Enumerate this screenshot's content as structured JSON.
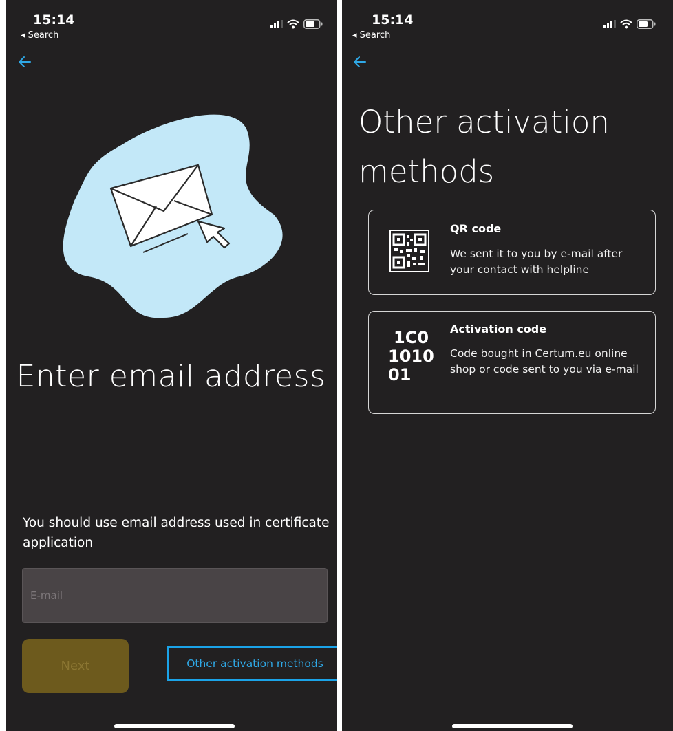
{
  "left_screen": {
    "status_bar": {
      "time": "15:14",
      "back_app": "◂ Search"
    },
    "title": "Enter email address",
    "hint": "You should use email address used in certificate application",
    "email_placeholder": "E-mail",
    "next_label": "Next",
    "other_methods_label": "Other activation methods"
  },
  "right_screen": {
    "status_bar": {
      "time": "15:14",
      "back_app": "◂ Search"
    },
    "title": "Other activation methods",
    "methods": [
      {
        "title": "QR code",
        "description": "We sent it to you by e-mail after your contact with helpline",
        "icon": "qr-code-icon"
      },
      {
        "title": "Activation code",
        "description": "Code bought in Certum.eu online shop or code sent to you via e-mail",
        "icon": "binary-code-icon",
        "icon_text": [
          "1C0",
          "1010",
          "01"
        ]
      }
    ]
  },
  "colors": {
    "background": "#222021",
    "accent_blue": "#2fa8e6",
    "highlight_border": "#1ba3e8",
    "next_button": "#6d5a1d",
    "blob": "#c3e8f8"
  }
}
